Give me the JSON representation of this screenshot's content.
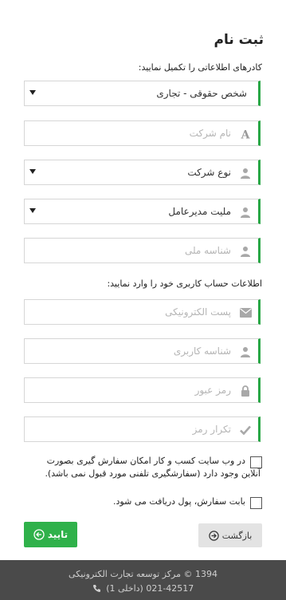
{
  "page": {
    "title": "ثبت نام",
    "instructions": "کادرهای اطلاعاتی را تکمیل نمایید:",
    "account_instructions": "اطلاعات حساب کاربری خود را وارد نمایید:"
  },
  "fields": {
    "person_type": {
      "value": "شخص حقوقی - تجاری"
    },
    "company_name": {
      "placeholder": "نام شرکت",
      "icon": "font-icon"
    },
    "company_type": {
      "value": "نوع شرکت",
      "icon": "user-icon"
    },
    "manager_nationality": {
      "value": "ملیت مدیرعامل",
      "icon": "user-icon"
    },
    "national_id": {
      "placeholder": "شناسه ملی",
      "icon": "user-icon"
    },
    "email": {
      "placeholder": "پست الکترونیکی",
      "icon": "envelope-icon"
    },
    "username": {
      "placeholder": "شناسه کاربری",
      "icon": "user-icon"
    },
    "password": {
      "placeholder": "رمز عبور",
      "icon": "lock-icon"
    },
    "password_repeat": {
      "placeholder": "تکرار رمز",
      "icon": "check-icon"
    }
  },
  "checkboxes": {
    "online_ordering": {
      "line1": "در وب سایت کسب و کار امکان سفارش گیری بصورت",
      "line2": "آنلاین وجود دارد (سفارشگیری تلفنی مورد قبول نمی باشد).",
      "checked": false
    },
    "payment": {
      "label": "بابت سفارش، پول دریافت می شود.",
      "checked": false
    }
  },
  "buttons": {
    "confirm_label": "تایید",
    "back_label": "بازگشت"
  },
  "footer": {
    "line1": "1394 © مرکز توسعه تجارت الکترونیکی",
    "phone": "021-42517 (داخلی 1)"
  },
  "colors": {
    "accent": "#2fb14a",
    "footer_bg": "#4a4a4a",
    "field_border_accent": "#28a745"
  }
}
